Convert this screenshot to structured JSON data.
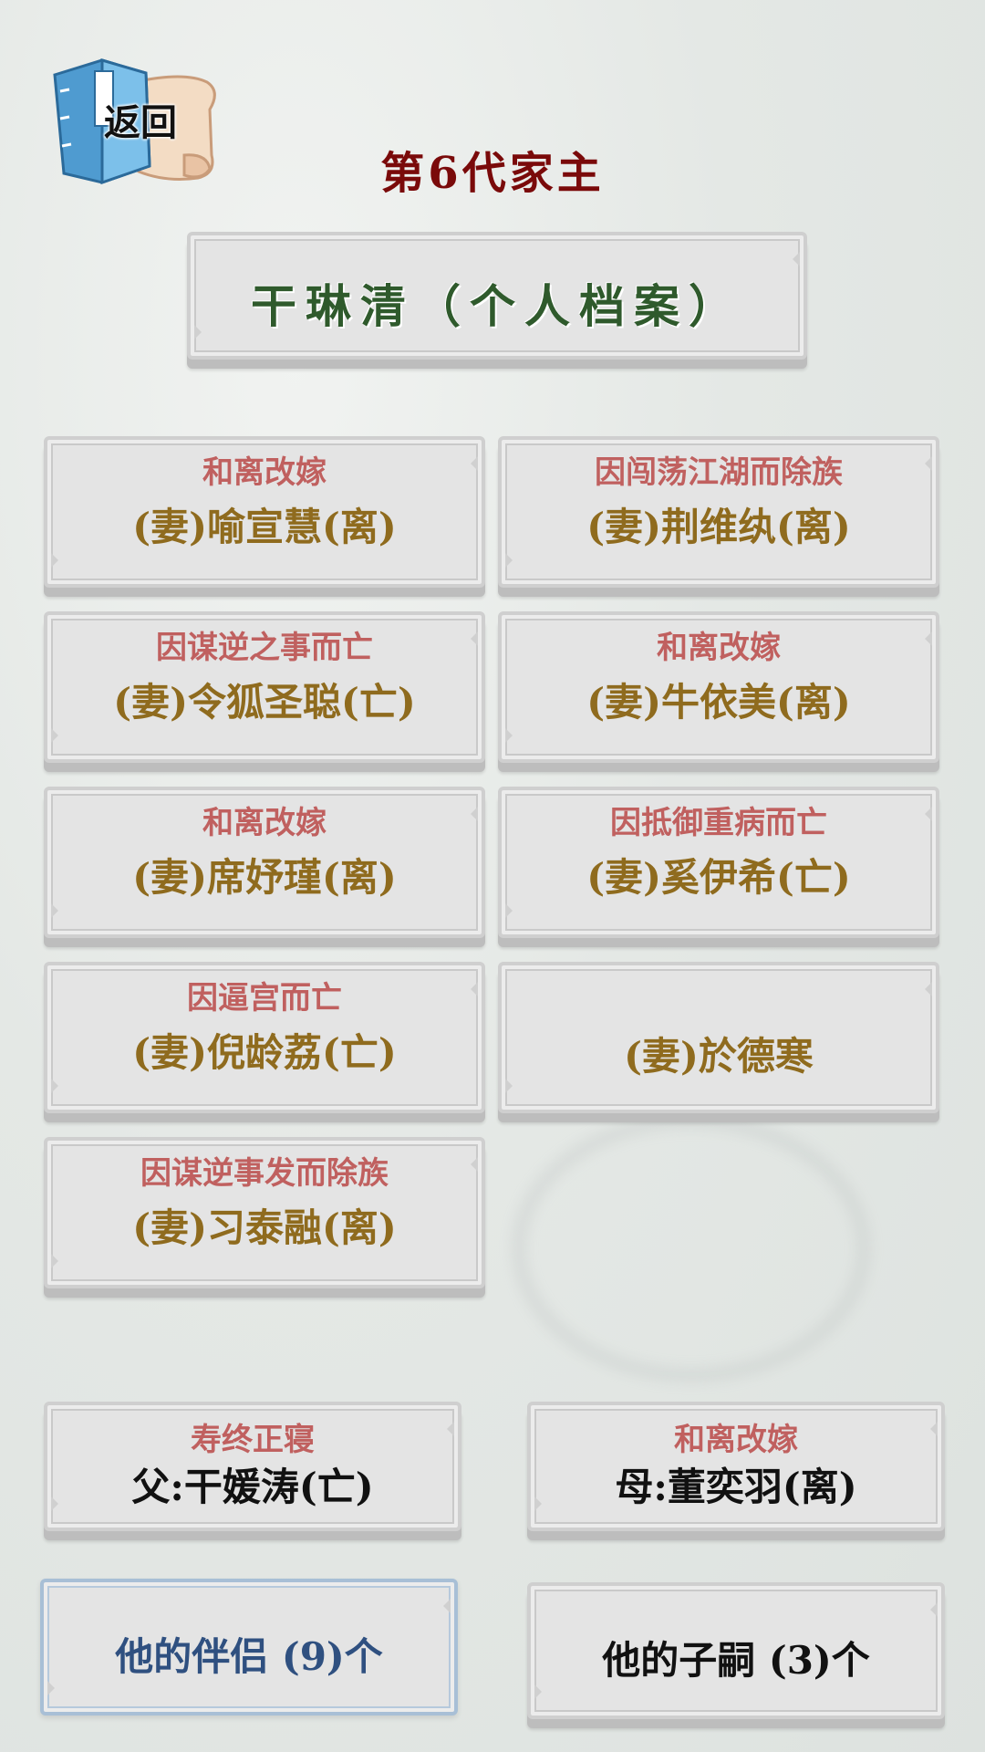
{
  "header": {
    "back_label": "返回",
    "generation_title": "第6代家主"
  },
  "profile": {
    "title": "干琳清（个人档案）"
  },
  "spouses": [
    {
      "cause": "和离改嫁",
      "name": "(妻)喻宣慧(离)"
    },
    {
      "cause": "因闯荡江湖而除族",
      "name": "(妻)荆维纨(离)"
    },
    {
      "cause": "因谋逆之事而亡",
      "name": "(妻)令狐圣聪(亡)"
    },
    {
      "cause": "和离改嫁",
      "name": "(妻)牛依美(离)"
    },
    {
      "cause": "和离改嫁",
      "name": "(妻)席妤瑾(离)"
    },
    {
      "cause": "因抵御重病而亡",
      "name": "(妻)奚伊希(亡)"
    },
    {
      "cause": "因逼宫而亡",
      "name": "(妻)倪龄荔(亡)"
    },
    {
      "cause": "",
      "name": "(妻)於德寒"
    },
    {
      "cause": "因谋逆事发而除族",
      "name": "(妻)习泰融(离)"
    }
  ],
  "parents": {
    "father": {
      "cause": "寿终正寝",
      "name": "父:干媛涛(亡)"
    },
    "mother": {
      "cause": "和离改嫁",
      "name": "母:董奕羽(离)"
    }
  },
  "tabs": {
    "partners": "他的伴侣 (9)个",
    "children": "他的子嗣 (3)个",
    "selected": "partners"
  },
  "colors": {
    "title_red": "#7a0a0a",
    "profile_green": "#2f5a2c",
    "cause_red": "#c0605f",
    "spouse_gold": "#8f6b1e",
    "selected_blue": "#2f5080"
  }
}
